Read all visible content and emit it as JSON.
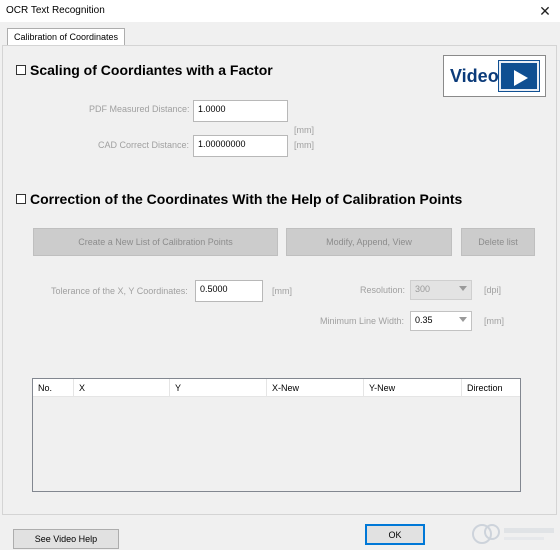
{
  "window": {
    "title": "OCR Text Recognition",
    "close_glyph": "✕"
  },
  "tab": {
    "label": "Calibration of Coordinates"
  },
  "scaling": {
    "title": "Scaling of Coordiantes with a Factor",
    "pdf_label": "PDF Measured Distance:",
    "pdf_value": "1.0000",
    "pdf_unit": "[mm]",
    "cad_label": "CAD Correct Distance:",
    "cad_value": "1.00000000",
    "cad_unit": "[mm]"
  },
  "video": {
    "label": "Video"
  },
  "correction": {
    "title": "Correction of the Coordinates With the Help of Calibration Points",
    "create_btn": "Create a New List of Calibration Points",
    "modify_btn": "Modify, Append, View",
    "delete_btn": "Delete list",
    "tolerance_label": "Tolerance of the X, Y Coordinates:",
    "tolerance_value": "0.5000",
    "tolerance_unit": "[mm]",
    "resolution_label": "Resolution:",
    "resolution_value": "300",
    "resolution_unit": "[dpi]",
    "min_line_label": "Minimum Line Width:",
    "min_line_value": "0.35",
    "min_line_unit": "[mm]"
  },
  "table": {
    "columns": [
      "No.",
      "X",
      "Y",
      "X-New",
      "Y-New",
      "Direction"
    ]
  },
  "footer": {
    "help_btn": "See Video Help",
    "ok_btn": "OK"
  },
  "colors": {
    "video_blue": "#0f4f92",
    "accent": "#0078d7"
  }
}
